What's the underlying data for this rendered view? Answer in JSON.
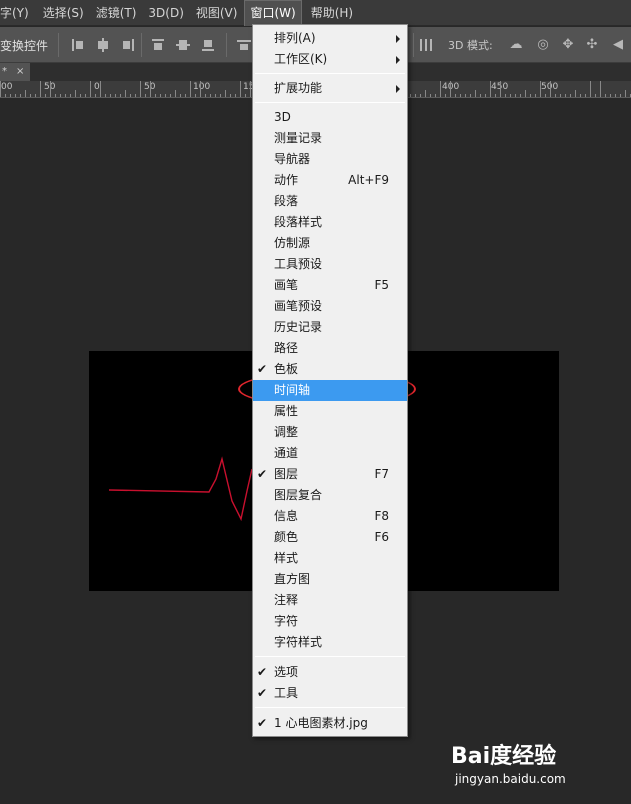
{
  "menubar": {
    "items": [
      {
        "label": "字(Y)"
      },
      {
        "label": "选择(S)"
      },
      {
        "label": "滤镜(T)"
      },
      {
        "label": "3D(D)"
      },
      {
        "label": "视图(V)"
      },
      {
        "label": "窗口(W)"
      },
      {
        "label": "帮助(H)"
      }
    ]
  },
  "options_bar": {
    "transform_label": "变换控件",
    "mode_3d_label": "3D 模式:"
  },
  "tab": {
    "label": "*",
    "close": "×"
  },
  "ruler": {
    "labels": [
      "00",
      "50",
      "0",
      "50",
      "100",
      "150",
      "400",
      "450",
      "500"
    ]
  },
  "window_menu": {
    "items": [
      {
        "label": "排列(A)",
        "submenu": true
      },
      {
        "label": "工作区(K)",
        "submenu": true
      },
      {
        "label": "扩展功能",
        "submenu": true
      },
      {
        "label": "3D"
      },
      {
        "label": "测量记录"
      },
      {
        "label": "导航器"
      },
      {
        "label": "动作",
        "shortcut": "Alt+F9"
      },
      {
        "label": "段落"
      },
      {
        "label": "段落样式"
      },
      {
        "label": "仿制源"
      },
      {
        "label": "工具预设"
      },
      {
        "label": "画笔",
        "shortcut": "F5"
      },
      {
        "label": "画笔预设"
      },
      {
        "label": "历史记录"
      },
      {
        "label": "路径"
      },
      {
        "label": "色板",
        "checked": true
      },
      {
        "label": "时间轴",
        "highlighted": true
      },
      {
        "label": "属性"
      },
      {
        "label": "调整"
      },
      {
        "label": "通道"
      },
      {
        "label": "图层",
        "shortcut": "F7",
        "checked": true
      },
      {
        "label": "图层复合"
      },
      {
        "label": "信息",
        "shortcut": "F8"
      },
      {
        "label": "颜色",
        "shortcut": "F6"
      },
      {
        "label": "样式"
      },
      {
        "label": "直方图"
      },
      {
        "label": "注释"
      },
      {
        "label": "字符"
      },
      {
        "label": "字符样式"
      },
      {
        "label": "选项",
        "checked": true
      },
      {
        "label": "工具",
        "checked": true
      },
      {
        "label": "1 心电图素材.jpg",
        "checked": true
      }
    ],
    "check_glyph": "✔"
  },
  "watermark": {
    "logo": "Bai度经验",
    "url": "jingyan.baidu.com"
  },
  "colors": {
    "highlight": "#3c9af0",
    "annotation": "#e0262d",
    "ecg_line": "#c8102e"
  }
}
